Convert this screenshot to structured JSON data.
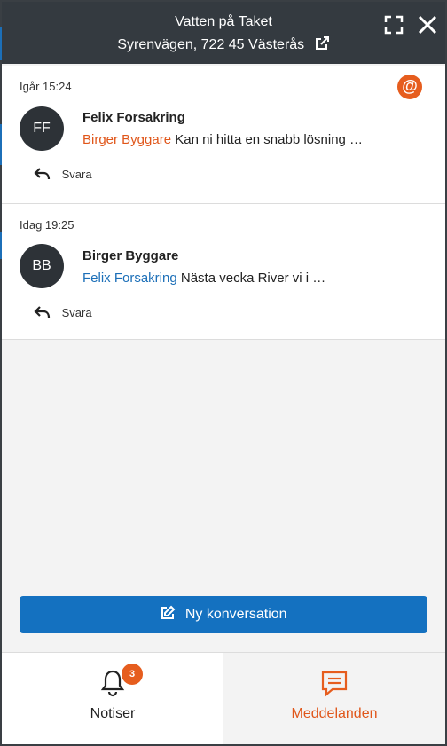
{
  "header": {
    "title": "Vatten på Taket",
    "address": "Syrenvägen, 722 45 Västerås"
  },
  "conversations": [
    {
      "timestamp": "Igår 15:24",
      "initials": "FF",
      "sender": "Felix Forsakring",
      "mention": "Birger Byggare",
      "text": "Kan ni hitta en snabb lösning …",
      "reply_label": "Svara"
    },
    {
      "timestamp": "Idag 19:25",
      "initials": "BB",
      "sender": "Birger Byggare",
      "mention": "Felix Forsakring",
      "text": "Nästa vecka River vi i …",
      "reply_label": "Svara"
    }
  ],
  "mention_badge": "@",
  "new_conversation_label": "Ny konversation",
  "tabs": {
    "notifications": {
      "label": "Notiser",
      "count": "3"
    },
    "messages": {
      "label": "Meddelanden"
    }
  },
  "colors": {
    "accent_orange": "#e65d1e",
    "primary_blue": "#1471c0",
    "header_dark": "#343a40"
  }
}
